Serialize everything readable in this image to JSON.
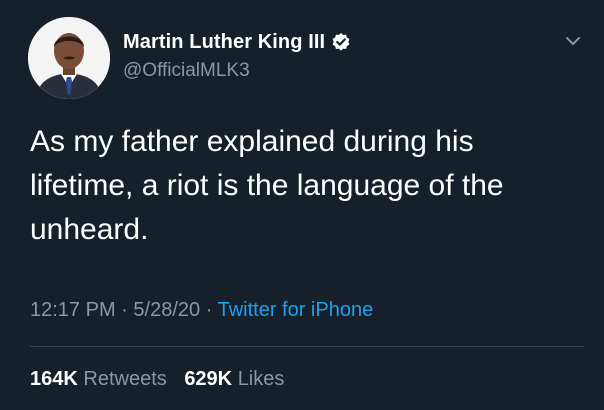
{
  "author": {
    "display_name": "Martin Luther King III",
    "handle": "@OfficialMLK3",
    "verified": true
  },
  "tweet": {
    "text": "As my father explained during his\nlifetime, a riot is the language of the\nunheard."
  },
  "meta": {
    "time": "12:17 PM",
    "separator": "·",
    "date": "5/28/20",
    "source": "Twitter for iPhone"
  },
  "stats": {
    "retweets_count": "164K",
    "retweets_label": "Retweets",
    "likes_count": "629K",
    "likes_label": "Likes"
  },
  "icons": {
    "verified": "verified-badge-icon",
    "more": "chevron-down-icon"
  },
  "colors": {
    "background": "#15202b",
    "secondary_text": "#8899a6",
    "accent": "#1da1f2",
    "divider": "#38444d"
  }
}
